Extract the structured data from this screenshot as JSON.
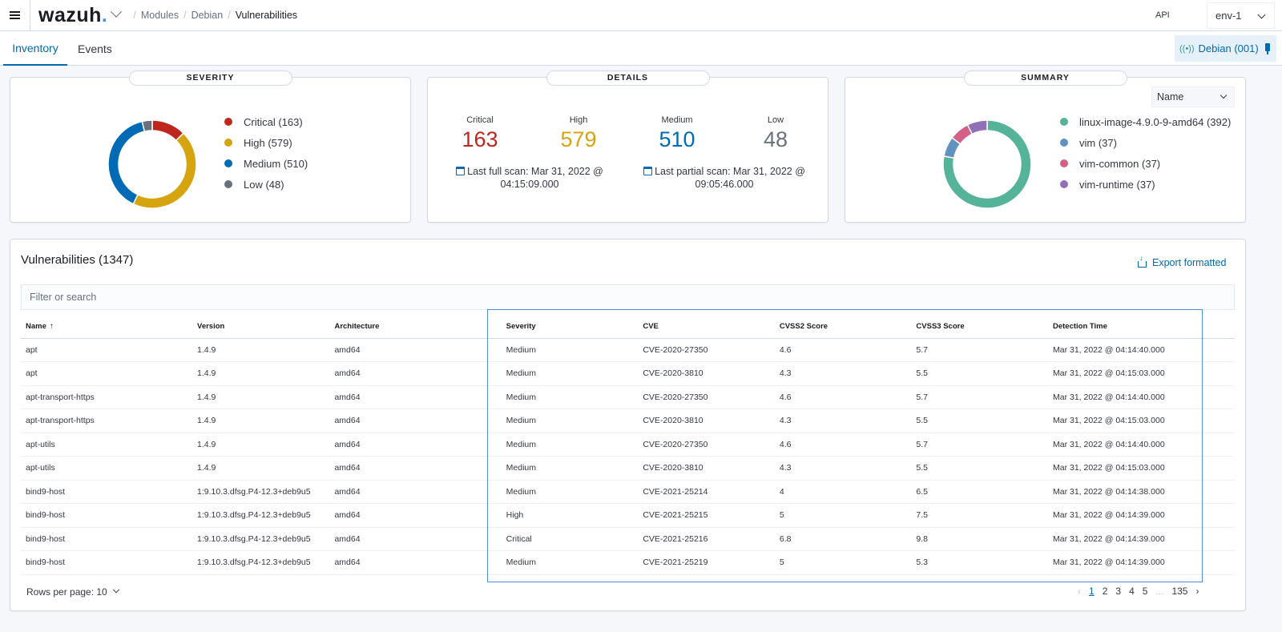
{
  "header": {
    "logo": "wazuh",
    "breadcrumb": [
      "Modules",
      "Debian",
      "Vulnerabilities"
    ],
    "api_label": "API",
    "api_selected": "env-1"
  },
  "tabs": [
    {
      "label": "Inventory",
      "active": true
    },
    {
      "label": "Events",
      "active": false
    }
  ],
  "agent_badge": "Debian (001)",
  "severity_panel": {
    "title": "SEVERITY",
    "items": [
      {
        "label": "Critical (163)",
        "value": 163,
        "color": "#BD271E"
      },
      {
        "label": "High (579)",
        "value": 579,
        "color": "#D6A40F"
      },
      {
        "label": "Medium (510)",
        "value": 510,
        "color": "#006BB4"
      },
      {
        "label": "Low (48)",
        "value": 48,
        "color": "#6A717D"
      }
    ]
  },
  "details_panel": {
    "title": "DETAILS",
    "stats": [
      {
        "label": "Critical",
        "value": "163",
        "color": "#BD271E"
      },
      {
        "label": "High",
        "value": "579",
        "color": "#D6A40F"
      },
      {
        "label": "Medium",
        "value": "510",
        "color": "#006BB4"
      },
      {
        "label": "Low",
        "value": "48",
        "color": "#6A717D"
      }
    ],
    "last_full_scan": "Last full scan: Mar 31, 2022 @ 04:15:09.000",
    "last_partial_scan": "Last partial scan: Mar 31, 2022 @ 09:05:46.000"
  },
  "summary_panel": {
    "title": "SUMMARY",
    "select_value": "Name",
    "items": [
      {
        "label": "linux-image-4.9.0-9-amd64 (392)",
        "value": 392,
        "color": "#54B399"
      },
      {
        "label": "vim (37)",
        "value": 37,
        "color": "#6092C0"
      },
      {
        "label": "vim-common (37)",
        "value": 37,
        "color": "#D36086"
      },
      {
        "label": "vim-runtime (37)",
        "value": 37,
        "color": "#9170B8"
      }
    ]
  },
  "vulnerabilities": {
    "title": "Vulnerabilities (1347)",
    "export_label": "Export formatted",
    "search_placeholder": "Filter or search",
    "columns": [
      "Name",
      "Version",
      "Architecture",
      "Severity",
      "CVE",
      "CVSS2 Score",
      "CVSS3 Score",
      "Detection Time"
    ],
    "rows": [
      [
        "apt",
        "1.4.9",
        "amd64",
        "Medium",
        "CVE-2020-27350",
        "4.6",
        "5.7",
        "Mar 31, 2022 @ 04:14:40.000"
      ],
      [
        "apt",
        "1.4.9",
        "amd64",
        "Medium",
        "CVE-2020-3810",
        "4.3",
        "5.5",
        "Mar 31, 2022 @ 04:15:03.000"
      ],
      [
        "apt-transport-https",
        "1.4.9",
        "amd64",
        "Medium",
        "CVE-2020-27350",
        "4.6",
        "5.7",
        "Mar 31, 2022 @ 04:14:40.000"
      ],
      [
        "apt-transport-https",
        "1.4.9",
        "amd64",
        "Medium",
        "CVE-2020-3810",
        "4.3",
        "5.5",
        "Mar 31, 2022 @ 04:15:03.000"
      ],
      [
        "apt-utils",
        "1.4.9",
        "amd64",
        "Medium",
        "CVE-2020-27350",
        "4.6",
        "5.7",
        "Mar 31, 2022 @ 04:14:40.000"
      ],
      [
        "apt-utils",
        "1.4.9",
        "amd64",
        "Medium",
        "CVE-2020-3810",
        "4.3",
        "5.5",
        "Mar 31, 2022 @ 04:15:03.000"
      ],
      [
        "bind9-host",
        "1:9.10.3.dfsg.P4-12.3+deb9u5",
        "amd64",
        "Medium",
        "CVE-2021-25214",
        "4",
        "6.5",
        "Mar 31, 2022 @ 04:14:38.000"
      ],
      [
        "bind9-host",
        "1:9.10.3.dfsg.P4-12.3+deb9u5",
        "amd64",
        "High",
        "CVE-2021-25215",
        "5",
        "7.5",
        "Mar 31, 2022 @ 04:14:39.000"
      ],
      [
        "bind9-host",
        "1:9.10.3.dfsg.P4-12.3+deb9u5",
        "amd64",
        "Critical",
        "CVE-2021-25216",
        "6.8",
        "9.8",
        "Mar 31, 2022 @ 04:14:39.000"
      ],
      [
        "bind9-host",
        "1:9.10.3.dfsg.P4-12.3+deb9u5",
        "amd64",
        "Medium",
        "CVE-2021-25219",
        "5",
        "5.3",
        "Mar 31, 2022 @ 04:14:39.000"
      ]
    ],
    "rows_per_page": "Rows per page: 10",
    "pagination": {
      "pages": [
        "1",
        "2",
        "3",
        "4",
        "5",
        "...",
        "135"
      ],
      "current": "1"
    }
  }
}
